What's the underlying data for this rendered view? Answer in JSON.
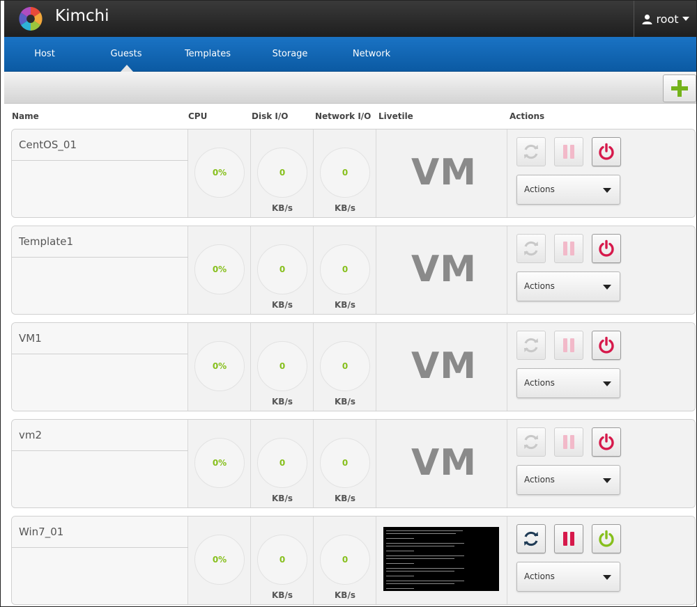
{
  "app": {
    "title": "Kimchi",
    "user": "root"
  },
  "nav": {
    "items": [
      {
        "label": "Host"
      },
      {
        "label": "Guests"
      },
      {
        "label": "Templates"
      },
      {
        "label": "Storage"
      },
      {
        "label": "Network"
      }
    ],
    "active": "Guests"
  },
  "table": {
    "headers": {
      "name": "Name",
      "cpu": "CPU",
      "disk": "Disk I/O",
      "network": "Network I/O",
      "livetile": "Livetile",
      "actions": "Actions"
    }
  },
  "guests": [
    {
      "name": "CentOS_01",
      "cpu": "0%",
      "disk": "0",
      "disk_unit": "KB/s",
      "network": "0",
      "network_unit": "KB/s",
      "livetile": "VM",
      "running": false,
      "actions_label": "Actions"
    },
    {
      "name": "Template1",
      "cpu": "0%",
      "disk": "0",
      "disk_unit": "KB/s",
      "network": "0",
      "network_unit": "KB/s",
      "livetile": "VM",
      "running": false,
      "actions_label": "Actions"
    },
    {
      "name": "VM1",
      "cpu": "0%",
      "disk": "0",
      "disk_unit": "KB/s",
      "network": "0",
      "network_unit": "KB/s",
      "livetile": "VM",
      "running": false,
      "actions_label": "Actions"
    },
    {
      "name": "vm2",
      "cpu": "0%",
      "disk": "0",
      "disk_unit": "KB/s",
      "network": "0",
      "network_unit": "KB/s",
      "livetile": "VM",
      "running": false,
      "actions_label": "Actions"
    },
    {
      "name": "Win7_01",
      "cpu": "0%",
      "disk": "0",
      "disk_unit": "KB/s",
      "network": "0",
      "network_unit": "KB/s",
      "livetile": "",
      "running": true,
      "actions_label": "Actions"
    }
  ],
  "icons": {
    "logo": "kimchi-logo-icon",
    "user": "user-icon",
    "add": "plus-icon",
    "reset": "refresh-icon",
    "pause": "pause-icon",
    "power": "power-icon"
  },
  "colors": {
    "nav": "#0b5aa3",
    "gauge_value": "#86bf1c",
    "power_stopped": "#d6194b",
    "power_running": "#86bf1c",
    "pause_active": "#d6194b",
    "pause_disabled": "#f2b9c9",
    "reset_active": "#1f3b55",
    "reset_disabled": "#c8c8c8"
  }
}
